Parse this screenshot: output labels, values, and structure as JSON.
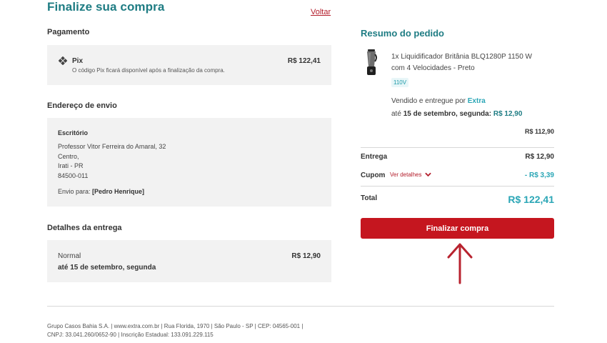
{
  "header": {
    "title": "Finalize sua compra",
    "back_label": "Voltar"
  },
  "payment": {
    "section_title": "Pagamento",
    "method": "Pix",
    "note": "O código Pix ficará disponível após a finalização da compra.",
    "amount": "R$ 122,41"
  },
  "shipping_address": {
    "section_title": "Endereço de envio",
    "label": "Escritório",
    "street": "Professor Vitor Ferreira do Amaral, 32",
    "district": "Centro,",
    "city": "Irati - PR",
    "zip": "84500-011",
    "ship_to_label": "Envio para:",
    "ship_to_name": "[Pedro Henrique]"
  },
  "delivery": {
    "section_title": "Detalhes da entrega",
    "type": "Normal",
    "date": "até 15 de setembro, segunda",
    "price": "R$ 12,90"
  },
  "summary": {
    "title": "Resumo do pedido",
    "product": {
      "name_line1": "1x Liquidificador Britânia BLQ1280P 1150 W",
      "name_line2": "com 4 Velocidades - Preto",
      "voltage": "110V",
      "sold_by_prefix": "Vendido e entregue por",
      "seller": "Extra",
      "delivery_prefix": "até",
      "delivery_date": "15 de setembro, segunda:",
      "delivery_price": "R$ 12,90",
      "price": "R$ 112,90"
    },
    "shipping_label": "Entrega",
    "shipping_value": "R$ 12,90",
    "coupon_label": "Cupom",
    "coupon_details": "Ver detalhes",
    "coupon_value": "- R$ 3,39",
    "total_label": "Total",
    "total_value": "R$ 122,41",
    "checkout_button": "Finalizar compra"
  },
  "footer": {
    "line1": "Grupo Casos Bahia S.A. | www.extra.com.br | Rua Florida, 1970 | São Paulo - SP | CEP: 04565-001 |",
    "line2": "CNPJ: 33.041.260/0652-90 | Inscrição Estadual: 133.091.229.115"
  },
  "colors": {
    "brand_teal": "#1e7c83",
    "accent_red": "#c5161f",
    "discount_teal": "#2aa6b6"
  },
  "icons": [
    "pix-icon",
    "product-thumbnail",
    "chevron-down-icon",
    "up-arrow-annotation"
  ]
}
